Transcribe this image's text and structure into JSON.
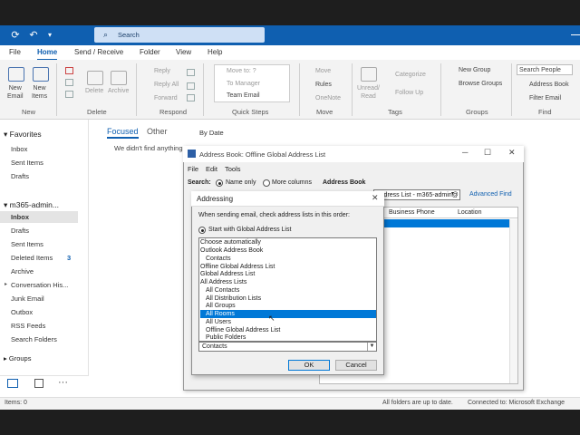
{
  "search": {
    "placeholder": "Search"
  },
  "tabs": [
    "File",
    "Home",
    "Send / Receive",
    "Folder",
    "View",
    "Help"
  ],
  "ribbon": {
    "new_email": "New\nEmail",
    "new_items": "New\nItems",
    "delete": "Delete",
    "archive": "Archive",
    "reply": "Reply",
    "reply_all": "Reply All",
    "forward": "Forward",
    "move_to": "Move to: ?",
    "to_manager": "To Manager",
    "team_email": "Team Email",
    "move": "Move",
    "rules": "Rules",
    "onenote": "OneNote",
    "unread_read": "Unread/\nRead",
    "categorize": "Categorize",
    "follow_up": "Follow Up",
    "new_group": "New Group",
    "browse_groups": "Browse Groups",
    "search_people": "Search People",
    "address_book": "Address Book",
    "filter_email": "Filter Email",
    "groups_labels": [
      "New",
      "Delete",
      "Respond",
      "Quick Steps",
      "Move",
      "Tags",
      "Groups",
      "Find"
    ]
  },
  "nav": {
    "favorites": "Favorites",
    "fav_items": [
      "Inbox",
      "Sent Items",
      "Drafts"
    ],
    "account": "m365-admin...",
    "account_items": [
      "Inbox",
      "Drafts",
      "Sent Items",
      "Deleted Items",
      "Archive",
      "Conversation His...",
      "Junk Email",
      "Outbox",
      "RSS Feeds",
      "Search Folders"
    ],
    "deleted_count": "3",
    "groups": "Groups"
  },
  "msglist": {
    "focused": "Focused",
    "other": "Other",
    "sort": "By Date",
    "empty_msg": "We didn't find anything"
  },
  "status": {
    "items": "Items: 0",
    "folders": "All folders are up to date.",
    "connected": "Connected to: Microsoft Exchange"
  },
  "address_book": {
    "title": "Address Book: Offline Global Address List",
    "menu": [
      "File",
      "Edit",
      "Tools"
    ],
    "search_label": "Search:",
    "name_only": "Name only",
    "more_columns": "More columns",
    "address_book_label": "Address Book",
    "dropdown_value": "Address List - m365-admin@",
    "advanced_find": "Advanced Find",
    "col_business_phone": "Business Phone",
    "col_location": "Location"
  },
  "addressing": {
    "title": "Addressing",
    "instruction": "When sending email, check address lists in this order:",
    "start_with": "Start with Global Address List",
    "list_items": [
      "Choose automatically",
      "Outlook Address Book",
      "Contacts",
      "Offline Global Address List",
      "Global Address List",
      "All Address Lists",
      "All Contacts",
      "All Distribution Lists",
      "All Groups",
      "All Rooms",
      "All Users",
      "Offline Global Address List",
      "Public Folders"
    ],
    "selected_index": 9,
    "combo_value": "Contacts",
    "ok": "OK",
    "cancel": "Cancel"
  }
}
